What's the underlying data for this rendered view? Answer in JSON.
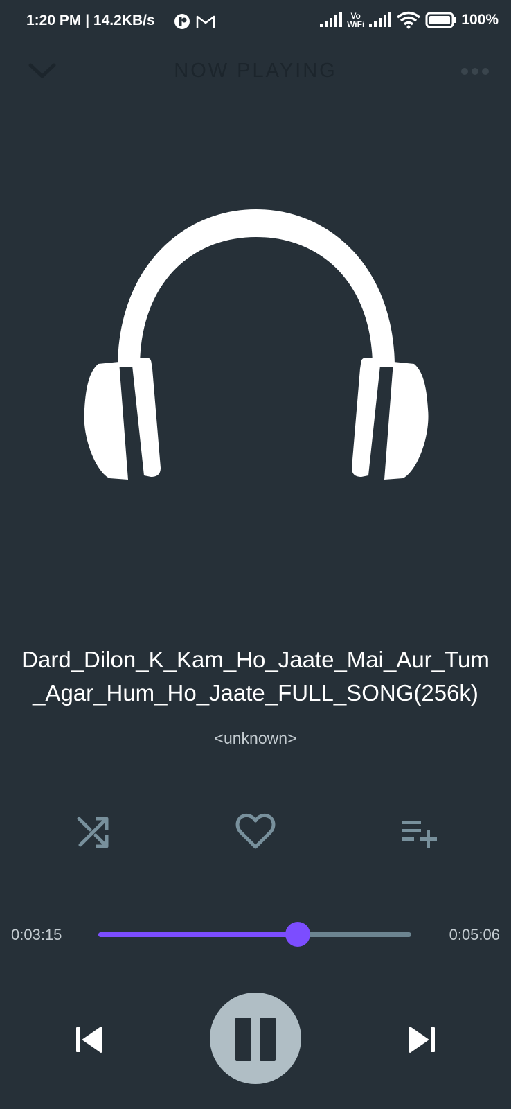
{
  "status_bar": {
    "time_and_speed": "1:20 PM | 14.2KB/s",
    "vowifi_top": "Vo",
    "vowifi_bottom": "WiFi",
    "battery_text": "100%"
  },
  "header": {
    "title": "NOW PLAYING",
    "collapse_icon": "chevron-down-icon",
    "more_icon": "more-horizontal-icon"
  },
  "album_art": {
    "icon": "headphones-icon"
  },
  "song": {
    "title_line1": "Dard_Dilon_K_Kam_Ho_Jaate_Mai_Aur_Tum",
    "title_line2": "_Agar_Hum_Ho_Jaate_FULL_SONG(256k)",
    "artist": "<unknown>"
  },
  "actions": {
    "shuffle_icon": "shuffle-icon",
    "favorite_icon": "heart-outline-icon",
    "queue_icon": "playlist-add-icon"
  },
  "progress": {
    "elapsed": "0:03:15",
    "total": "0:05:06",
    "fraction": 0.637
  },
  "transport": {
    "prev_icon": "skip-previous-icon",
    "pause_icon": "pause-icon",
    "next_icon": "skip-next-icon"
  },
  "colors": {
    "background": "#263038",
    "accent": "#7c4dff",
    "track": "#6c8490",
    "play_button": "#b0bec5",
    "muted_icon": "#78909c"
  }
}
